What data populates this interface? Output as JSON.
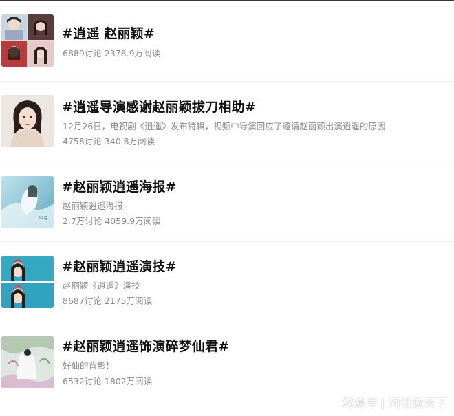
{
  "topics": [
    {
      "title": "#逍遥 赵丽颖#",
      "description": "",
      "stats": "6889讨论 2378.9万阅读",
      "thumb_icon": "four-photo-collage"
    },
    {
      "title": "#逍遥导演感谢赵丽颖拔刀相助#",
      "description": "12月26日，电视剧《逍遥》发布特辑，视频中导演回应了邀请赵丽颖出演逍遥的原因",
      "stats": "4758讨论 340.8万阅读",
      "thumb_icon": "portrait-photo"
    },
    {
      "title": "#赵丽颖逍遥海报#",
      "description": "赵丽颖逍遥海报",
      "stats": "2.7万讨论 4059.9万阅读",
      "thumb_icon": "poster-photo"
    },
    {
      "title": "#赵丽颖逍遥演技#",
      "description": "赵丽颖《逍遥》演技",
      "stats": "8687讨论 2175万阅读",
      "thumb_icon": "two-photo-stack"
    },
    {
      "title": "#赵丽颖逍遥饰演碎梦仙君#",
      "description": "好仙的背影！",
      "stats": "6532讨论 1802万阅读",
      "thumb_icon": "scene-photo"
    }
  ],
  "watermark": {
    "logo": "网易号",
    "separator": "|",
    "author": "阿讯说天下"
  }
}
